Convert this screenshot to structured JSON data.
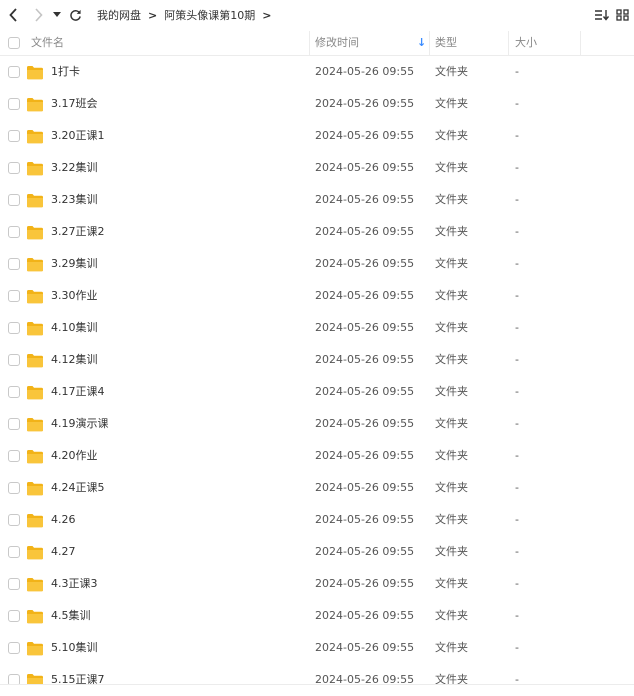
{
  "toolbar": {
    "back_icon": "chevron-left-icon",
    "forward_icon": "chevron-right-icon",
    "history_icon": "caret-down-icon",
    "refresh_icon": "refresh-icon",
    "sort_icon": "sort-list-icon",
    "grid_icon": "grid-view-icon"
  },
  "breadcrumb": {
    "items": [
      "我的网盘",
      "阿策头像课第10期"
    ],
    "separator": ">"
  },
  "header": {
    "name": "文件名",
    "modified": "修改时间",
    "type": "类型",
    "size": "大小",
    "sort_indicator": "↓",
    "sort_color": "#3b8cff"
  },
  "colors": {
    "folder": "#f9c53b",
    "folder_dark": "#f2b318"
  },
  "rows": [
    {
      "name": "1打卡",
      "modified": "2024-05-26 09:55",
      "type": "文件夹",
      "size": "-"
    },
    {
      "name": "3.17班会",
      "modified": "2024-05-26 09:55",
      "type": "文件夹",
      "size": "-"
    },
    {
      "name": "3.20正课1",
      "modified": "2024-05-26 09:55",
      "type": "文件夹",
      "size": "-"
    },
    {
      "name": "3.22集训",
      "modified": "2024-05-26 09:55",
      "type": "文件夹",
      "size": "-"
    },
    {
      "name": "3.23集训",
      "modified": "2024-05-26 09:55",
      "type": "文件夹",
      "size": "-"
    },
    {
      "name": "3.27正课2",
      "modified": "2024-05-26 09:55",
      "type": "文件夹",
      "size": "-"
    },
    {
      "name": "3.29集训",
      "modified": "2024-05-26 09:55",
      "type": "文件夹",
      "size": "-"
    },
    {
      "name": "3.30作业",
      "modified": "2024-05-26 09:55",
      "type": "文件夹",
      "size": "-"
    },
    {
      "name": "4.10集训",
      "modified": "2024-05-26 09:55",
      "type": "文件夹",
      "size": "-"
    },
    {
      "name": "4.12集训",
      "modified": "2024-05-26 09:55",
      "type": "文件夹",
      "size": "-"
    },
    {
      "name": "4.17正课4",
      "modified": "2024-05-26 09:55",
      "type": "文件夹",
      "size": "-"
    },
    {
      "name": "4.19演示课",
      "modified": "2024-05-26 09:55",
      "type": "文件夹",
      "size": "-"
    },
    {
      "name": "4.20作业",
      "modified": "2024-05-26 09:55",
      "type": "文件夹",
      "size": "-"
    },
    {
      "name": "4.24正课5",
      "modified": "2024-05-26 09:55",
      "type": "文件夹",
      "size": "-"
    },
    {
      "name": "4.26",
      "modified": "2024-05-26 09:55",
      "type": "文件夹",
      "size": "-"
    },
    {
      "name": "4.27",
      "modified": "2024-05-26 09:55",
      "type": "文件夹",
      "size": "-"
    },
    {
      "name": "4.3正课3",
      "modified": "2024-05-26 09:55",
      "type": "文件夹",
      "size": "-"
    },
    {
      "name": "4.5集训",
      "modified": "2024-05-26 09:55",
      "type": "文件夹",
      "size": "-"
    },
    {
      "name": "5.10集训",
      "modified": "2024-05-26 09:55",
      "type": "文件夹",
      "size": "-"
    },
    {
      "name": "5.15正课7",
      "modified": "2024-05-26 09:55",
      "type": "文件夹",
      "size": "-"
    }
  ]
}
